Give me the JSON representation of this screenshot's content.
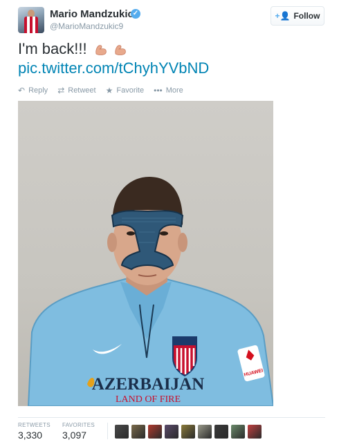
{
  "user": {
    "name": "Mario Mandzukic",
    "handle": "@MarioMandzukic9"
  },
  "follow_button": {
    "label": "Follow",
    "icon": "add-user-icon"
  },
  "tweet": {
    "text": "I'm back!!!",
    "emojis": [
      "flexed-biceps-icon",
      "flexed-biceps-icon"
    ],
    "link": "pic.twitter.com/tChyhYVbND"
  },
  "actions": [
    {
      "label": "Reply",
      "icon": "reply-icon"
    },
    {
      "label": "Retweet",
      "icon": "retweet-icon"
    },
    {
      "label": "Favorite",
      "icon": "star-icon"
    },
    {
      "label": "More",
      "icon": "more-dots-icon"
    }
  ],
  "photo": {
    "sponsor_line1": "AZERBAIJAN",
    "sponsor_line2": "LAND OF FIRE",
    "sleeve_sponsor": "HUAWEI"
  },
  "stats": {
    "retweets_label": "RETWEETS",
    "retweets_value": "3,330",
    "favorites_label": "FAVORITES",
    "favorites_value": "3,097"
  },
  "favoriter_avatar_colors": [
    "#4a4a4a",
    "#7a6a4a",
    "#b03a2e",
    "#5a4a6a",
    "#8a7a3a",
    "#9a9a8a",
    "#3a3a3a",
    "#6a8a6a",
    "#c04040"
  ],
  "colors": {
    "link": "#0084b4",
    "verified": "#55acee",
    "muted": "#8899a6"
  }
}
